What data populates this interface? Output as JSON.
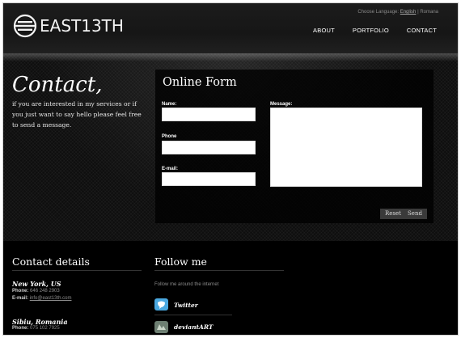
{
  "header": {
    "logo_text": "EAST13TH",
    "language": {
      "prompt": "Choose Language:",
      "options": [
        "English",
        "Romana"
      ],
      "separator": "|"
    },
    "nav": [
      "ABOUT",
      "PORTFOLIO",
      "CONTACT"
    ]
  },
  "hero": {
    "title": "Contact,",
    "intro": "if you are interested in my services or if you just want to say hello please feel free to send a message."
  },
  "form": {
    "title": "Online Form",
    "name_label": "Name:",
    "phone_label": "Phone",
    "email_label": "E-mail:",
    "message_label": "Message:",
    "reset_label": "Reset",
    "send_label": "Send"
  },
  "contact_details": {
    "title": "Contact details",
    "locations": [
      {
        "city": "New York, US",
        "phone_label": "Phone:",
        "phone": "646 248 2903",
        "email_label": "E-mail:",
        "email": "info@east13th.com"
      },
      {
        "city": "Sibiu, Romania",
        "phone_label": "Phone:",
        "phone": "075 102 7925"
      }
    ]
  },
  "follow": {
    "title": "Follow me",
    "subtitle": "Follow me around the internet",
    "links": [
      {
        "label": "Twitter",
        "icon": "twitter-icon",
        "color": "#4aa8e0"
      },
      {
        "label": "deviantART",
        "icon": "deviantart-icon",
        "color": "#6d7f72"
      }
    ]
  }
}
